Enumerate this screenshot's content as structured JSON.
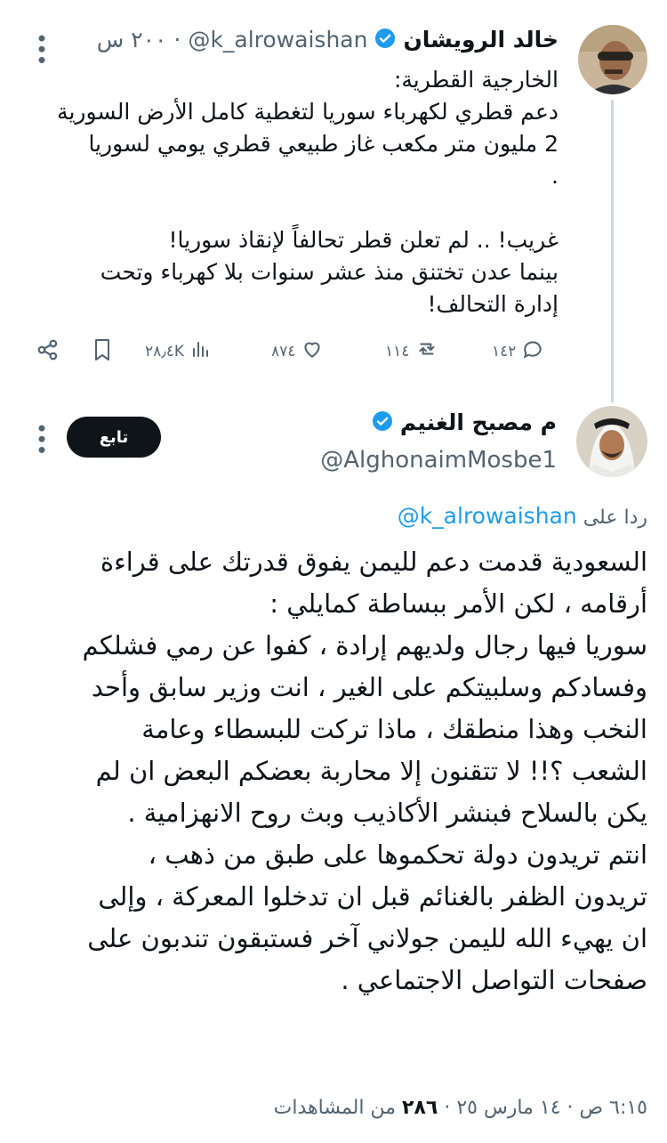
{
  "tweet1": {
    "name": "خالد الرويشان",
    "handle": "@k_alrowaishan",
    "time": "٢٠٠ س",
    "body": "الخارجية القطرية:\nدعم قطري لكهرباء سوريا لتغطية كامل الأرض السورية\n2 مليون متر مكعب غاز طبيعي قطري يومي لسوريا\n.\n\nغريب! .. لم تعلن قطر تحالفاً لإنقاذ سوريا!\nبينما عدن تختنق منذ عشر سنوات بلا كهرباء وتحت\nإدارة التحالف!",
    "replies": "١٤٢",
    "retweets": "١١٤",
    "likes": "٨٧٤",
    "views": "٢٨٫٤K"
  },
  "tweet2": {
    "name": "م مصبح الغنيم",
    "handle": "@AlghonaimMosbe1",
    "follow_label": "تابع",
    "reply_prefix": "ردا على",
    "reply_to": "@k_alrowaishan",
    "body": "السعودية قدمت دعم لليمن يفوق قدرتك على قراءة\nأرقامه ، لكن الأمر ببساطة كمايلي :\nسوريا فيها رجال ولديهم إرادة ، كفوا عن رمي فشلكم\nوفسادكم وسلبيتكم على الغير ، انت وزير سابق وأحد\nالنخب وهذا منطقك ، ماذا تركت للبسطاء وعامة\nالشعب ؟!! لا تتقنون إلا محاربة بعضكم البعض ان لم\nيكن بالسلاح فبنشر الأكاذيب وبث روح الانهزامية .\nانتم تريدون دولة تحكموها على طبق من ذهب ،\nتريدون الظفر بالغنائم قبل ان تدخلوا المعركة ، وإلى\nان يهيء الله لليمن جولاني آخر فستبقون تندبون على\nصفحات التواصل الاجتماعي .",
    "meta_time": "٦:١٥ ص · ١٤ مارس ٢٥ ·",
    "meta_views": "٢٨٦",
    "meta_views_label": "من المشاهدات"
  },
  "colors": {
    "verified": "#1d9bf0",
    "link": "#1d9bf0",
    "muted": "#536471",
    "thread_line": "#cfd9de"
  }
}
